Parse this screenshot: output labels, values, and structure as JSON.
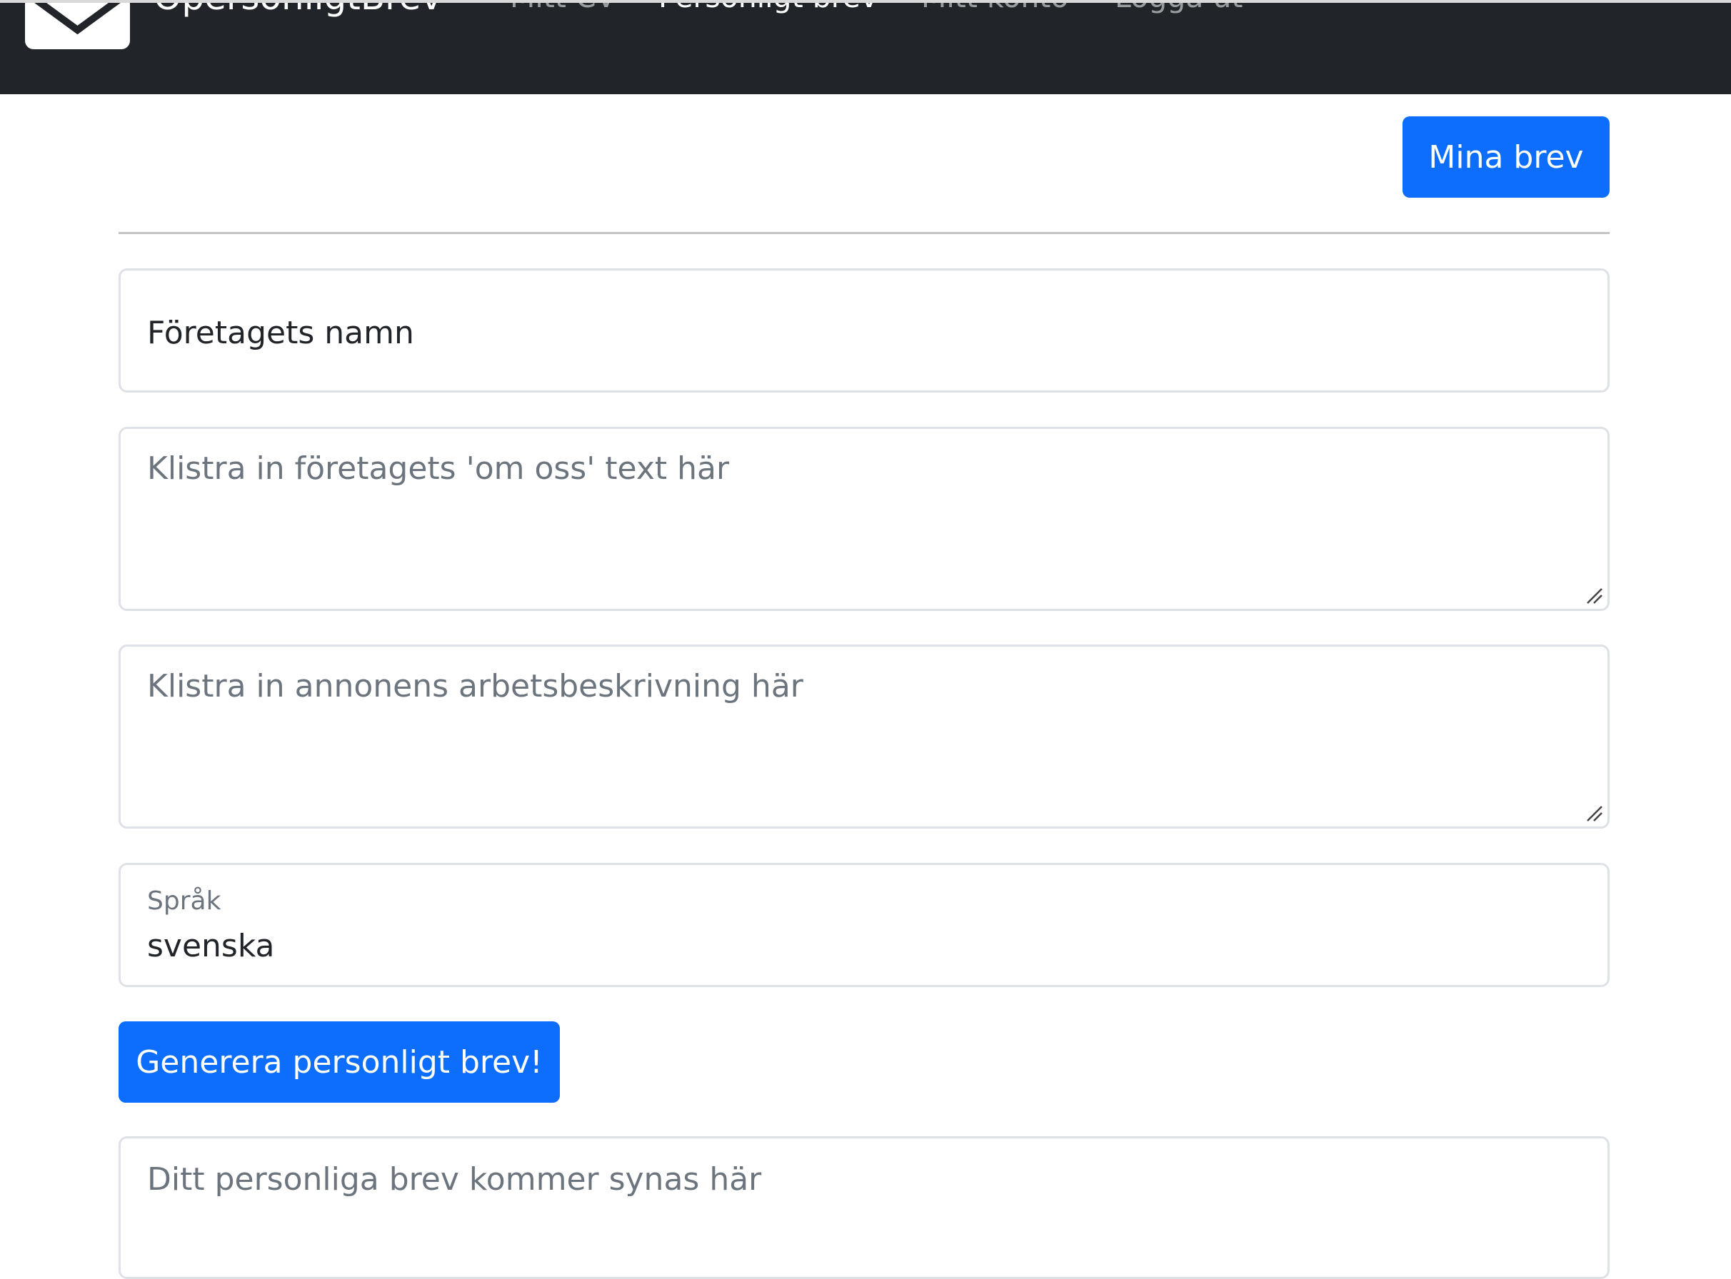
{
  "navbar": {
    "brand": "OpersonligtBrev",
    "links": [
      {
        "label": "Mitt CV",
        "active": false
      },
      {
        "label": "Personligt brev",
        "active": true
      },
      {
        "label": "Mitt konto",
        "active": false
      },
      {
        "label": "Logga ut",
        "active": false
      }
    ]
  },
  "actions": {
    "my_letters_label": "Mina brev"
  },
  "form": {
    "company_name": {
      "value": "Företagets namn"
    },
    "about_text": {
      "placeholder": "Klistra in företagets 'om oss' text här"
    },
    "job_description": {
      "placeholder": "Klistra in annonens arbetsbeskrivning här"
    },
    "language": {
      "label": "Språk",
      "value": "svenska"
    },
    "generate_label": "Generera personligt brev!",
    "output": {
      "placeholder": "Ditt personliga brev kommer synas här"
    }
  },
  "colors": {
    "navbar_bg": "#212529",
    "primary": "#0d6efd",
    "border": "#dee2e6",
    "placeholder": "#6c757d"
  },
  "icons": {
    "brand": "envelope-icon",
    "resize": "resize-grip-icon"
  }
}
